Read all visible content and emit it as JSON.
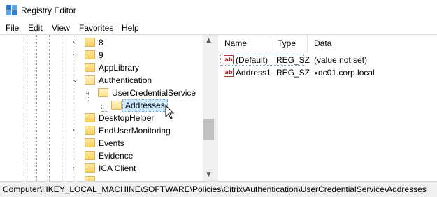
{
  "window": {
    "title": "Registry Editor"
  },
  "menu": [
    "File",
    "Edit",
    "View",
    "Favorites",
    "Help"
  ],
  "tree": {
    "items": [
      {
        "label": "8",
        "expander": "collapsed"
      },
      {
        "label": "9",
        "expander": "collapsed"
      },
      {
        "label": "AppLibrary",
        "expander": "none"
      },
      {
        "label": "Authentication",
        "expander": "expanded"
      },
      {
        "label": "UserCredentialService",
        "expander": "expanded"
      },
      {
        "label": "Addresses",
        "expander": "none",
        "selected": true
      },
      {
        "label": "DesktopHelper",
        "expander": "none"
      },
      {
        "label": "EndUserMonitoring",
        "expander": "collapsed"
      },
      {
        "label": "Events",
        "expander": "none"
      },
      {
        "label": "Evidence",
        "expander": "none"
      },
      {
        "label": "ICA Client",
        "expander": "collapsed"
      }
    ]
  },
  "list": {
    "columns": [
      "Name",
      "Type",
      "Data"
    ],
    "rows": [
      {
        "icon": "ab",
        "name": "(Default)",
        "type": "REG_SZ",
        "data": "(value not set)"
      },
      {
        "icon": "ab",
        "name": "Address1",
        "type": "REG_SZ",
        "data": "xdc01.corp.local"
      }
    ]
  },
  "status": {
    "path": "Computer\\HKEY_LOCAL_MACHINE\\SOFTWARE\\Policies\\Citrix\\Authentication\\UserCredentialService\\Addresses"
  }
}
